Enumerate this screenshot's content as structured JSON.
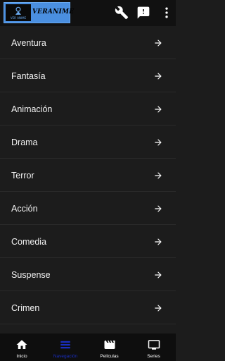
{
  "app": {
    "logo_small_text": "VER ANIME",
    "logo_text": "VERANIME"
  },
  "header": {
    "actions": [
      {
        "icon": "wrench-icon"
      },
      {
        "icon": "feedback-icon"
      },
      {
        "icon": "more-vert-icon"
      }
    ]
  },
  "categories": [
    {
      "label": "Aventura"
    },
    {
      "label": "Fantasía"
    },
    {
      "label": "Animación"
    },
    {
      "label": "Drama"
    },
    {
      "label": "Terror"
    },
    {
      "label": "Acción"
    },
    {
      "label": "Comedia"
    },
    {
      "label": "Suspense"
    },
    {
      "label": "Crimen"
    }
  ],
  "bottom_nav": {
    "active_index": 1,
    "active_color": "#1a2ec0",
    "tabs": [
      {
        "label": "Inicio",
        "icon": "home-icon"
      },
      {
        "label": "Navegación",
        "icon": "list-icon"
      },
      {
        "label": "Películas",
        "icon": "clapperboard-icon"
      },
      {
        "label": "Series",
        "icon": "tv-icon"
      }
    ]
  }
}
